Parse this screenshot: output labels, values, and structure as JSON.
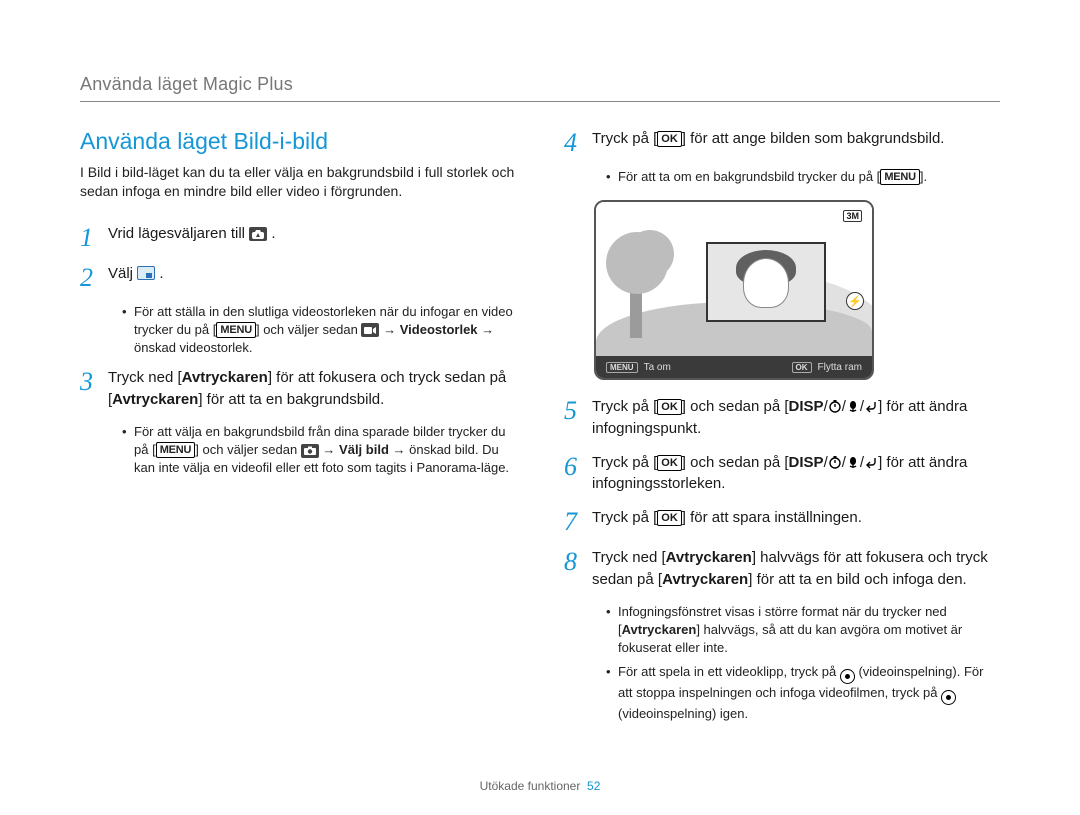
{
  "breadcrumb": "Använda läget Magic Plus",
  "section_title": "Använda läget Bild-i-bild",
  "intro": "I Bild i bild-läget kan du ta eller välja en bakgrundsbild i full storlek och sedan infoga en mindre bild eller video i förgrunden.",
  "buttons": {
    "ok": "OK",
    "menu": "MENU",
    "disp": "DISP"
  },
  "left_steps": {
    "s1": {
      "num": "1",
      "a": "Vrid lägesväljaren till ",
      "b": "."
    },
    "s2": {
      "num": "2",
      "a": "Välj ",
      "b": ".",
      "sub1_a": "För att ställa in den slutliga videostorleken när du infogar en video trycker du på [",
      "sub1_b": "] och väljer sedan ",
      "sub1_c": " → ",
      "sub1_bold": "Videostorlek",
      "sub1_d": " → önskad videostorlek."
    },
    "s3": {
      "num": "3",
      "a": "Tryck ned [",
      "b": "Avtryckaren",
      "c": "] för att fokusera och tryck sedan på [",
      "d": "Avtryckaren",
      "e": "] för att ta en bakgrundsbild.",
      "sub1_a": "För att välja en bakgrundsbild från dina sparade bilder trycker du på [",
      "sub1_b": "] och väljer sedan ",
      "sub1_c": " → ",
      "sub1_bold": "Välj bild",
      "sub1_d": " → önskad bild. Du kan inte välja en videofil eller ett foto som tagits i Panorama-läge."
    }
  },
  "right_steps": {
    "s4": {
      "num": "4",
      "a": "Tryck på [",
      "b": "] för att ange bilden som bakgrundsbild.",
      "sub1_a": "För att ta om en bakgrundsbild trycker du på [",
      "sub1_b": "]."
    },
    "s5": {
      "num": "5",
      "a": "Tryck på [",
      "b": "] och sedan på [",
      "c": "] för att ändra infogningspunkt."
    },
    "s6": {
      "num": "6",
      "a": "Tryck på [",
      "b": "] och sedan på [",
      "c": "] för att ändra infogningsstorleken."
    },
    "s7": {
      "num": "7",
      "a": "Tryck på [",
      "b": "] för att spara inställningen."
    },
    "s8": {
      "num": "8",
      "a": "Tryck ned [",
      "b": "Avtryckaren",
      "c": "] halvvägs för att fokusera och tryck sedan på [",
      "d": "Avtryckaren",
      "e": "] för att ta en bild och infoga den.",
      "sub1": "Infogningsfönstret visas i större format när du trycker ned [",
      "sub1b": "Avtryckaren",
      "sub1c": "] halvvägs, så att du kan avgöra om motivet är fokuserat eller inte.",
      "sub2a": "För att spela in ett videoklipp, tryck på ",
      "sub2b": " (videoinspelning). För att stoppa inspelningen och infoga videofilmen, tryck på ",
      "sub2c": " (videoinspelning) igen."
    }
  },
  "screenshot": {
    "badge_top": "3M",
    "badge_right": "⚡",
    "footer_left_tag": "MENU",
    "footer_left": "Ta om",
    "footer_right_tag": "OK",
    "footer_right": "Flytta ram"
  },
  "footer": {
    "label": "Utökade funktioner",
    "page": "52"
  }
}
